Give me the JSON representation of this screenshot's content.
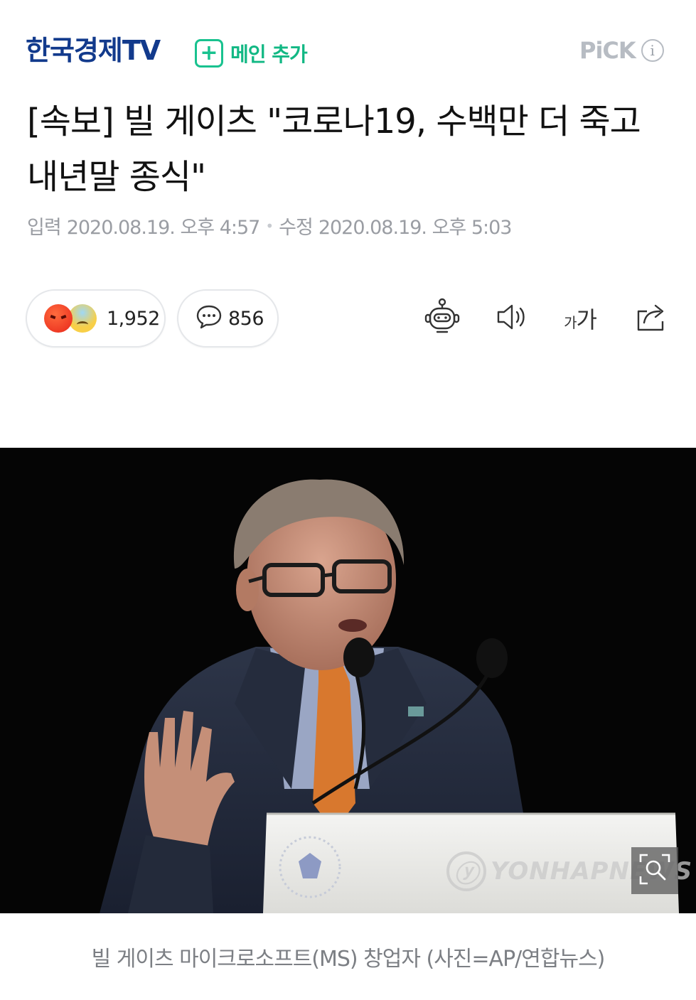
{
  "header": {
    "brand": "한국경제TV",
    "subscribe_label": "메인 추가",
    "subscribe_icon": "plus-icon",
    "pick_label": "PiCK",
    "pick_info_icon": "i",
    "brand_color": "#123a8c",
    "accent_color": "#19c28f"
  },
  "article": {
    "title": "[속보] 빌 게이츠 \"코로나19, 수백만 더 죽고 내년말 종식\"",
    "input_label": "입력",
    "input_date": "2020.08.19. 오후 4:57",
    "modified_label": "수정",
    "modified_date": "2020.08.19. 오후 5:03"
  },
  "actions": {
    "reaction_count": "1,952",
    "comment_count": "856",
    "tools": [
      "robot-summary-icon",
      "speaker-icon",
      "font-size-icon",
      "share-icon"
    ],
    "font_small": "가",
    "font_big": "가"
  },
  "photo": {
    "watermark": "YONHAPNEWS",
    "watermark_logo": "ⓨ",
    "caption": "빌 게이츠 마이크로소프트(MS) 창업자 (사진=AP/연합뉴스)"
  }
}
